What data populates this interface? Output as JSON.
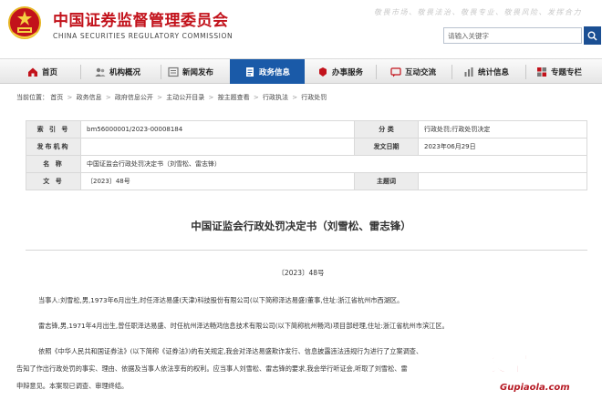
{
  "header": {
    "title_cn": "中国证券监督管理委员会",
    "title_en": "CHINA SECURITIES REGULATORY COMMISSION",
    "slogan": "敬畏市场、敬畏法治、敬畏专业、敬畏风险、发挥合力",
    "search_placeholder": "请输入关键字",
    "emblem_color": "#c2121b"
  },
  "nav": {
    "items": [
      {
        "label": "首页",
        "icon": "home-icon"
      },
      {
        "label": "机构概况",
        "icon": "people-icon"
      },
      {
        "label": "新闻发布",
        "icon": "news-icon"
      },
      {
        "label": "政务信息",
        "icon": "document-icon"
      },
      {
        "label": "办事服务",
        "icon": "service-icon"
      },
      {
        "label": "互动交流",
        "icon": "chat-icon"
      },
      {
        "label": "统计信息",
        "icon": "chart-icon"
      },
      {
        "label": "专题专栏",
        "icon": "topic-icon"
      }
    ],
    "active_color": "#1a5aa8"
  },
  "breadcrumb": {
    "prefix": "当前位置：",
    "items": [
      "首页",
      "政务信息",
      "政府信息公开",
      "主动公开目录",
      "按主题查看",
      "行政执法",
      "行政处罚"
    ],
    "separator": ">"
  },
  "info": {
    "index_label": "索 引 号",
    "index_value": "bm56000001/2023-00008184",
    "category_label": "分 类",
    "category_value": "行政处罚;行政处罚决定",
    "issuer_label": "发布机构",
    "issuer_value": "",
    "date_label": "发文日期",
    "date_value": "2023年06月29日",
    "name_label": "名 称",
    "name_value": "中国证监会行政处罚决定书（刘雪松、雷志锋）",
    "docno_label": "文 号",
    "docno_value": "〔2023〕48号",
    "topic_label": "主题词",
    "topic_value": ""
  },
  "document": {
    "title": "中国证监会行政处罚决定书（刘雪松、雷志锋）",
    "number": "〔2023〕48号",
    "paragraphs": [
      "当事人:刘雪松,男,1973年6月出生,时任泽达易盛(天津)科技股份有限公司(以下简称泽达易盛)董事,住址:浙江省杭州市西湖区。",
      "雷志锋,男,1971年4月出生,曾任职泽达易盛、时任杭州泽达畅鸿信息技术有限公司(以下简称杭州畅鸿)项目部经理,住址:浙江省杭州市滨江区。",
      "依照《中华人民共和国证券法》(以下简称《证券法》)的有关规定,我会对泽达易盛欺诈发行、信息披露违法违规行为进行了立案调查、",
      "告知了作出行政处罚的事实、理由、依据及当事人依法享有的权利。应当事人刘雪松、雷志锋的要求,我会举行听证会,听取了刘雪松、雷",
      "申辩意见。本案现已调查、审理终结。"
    ]
  },
  "watermark": {
    "text": "股票啦",
    "url": "Gupiaola.com"
  }
}
